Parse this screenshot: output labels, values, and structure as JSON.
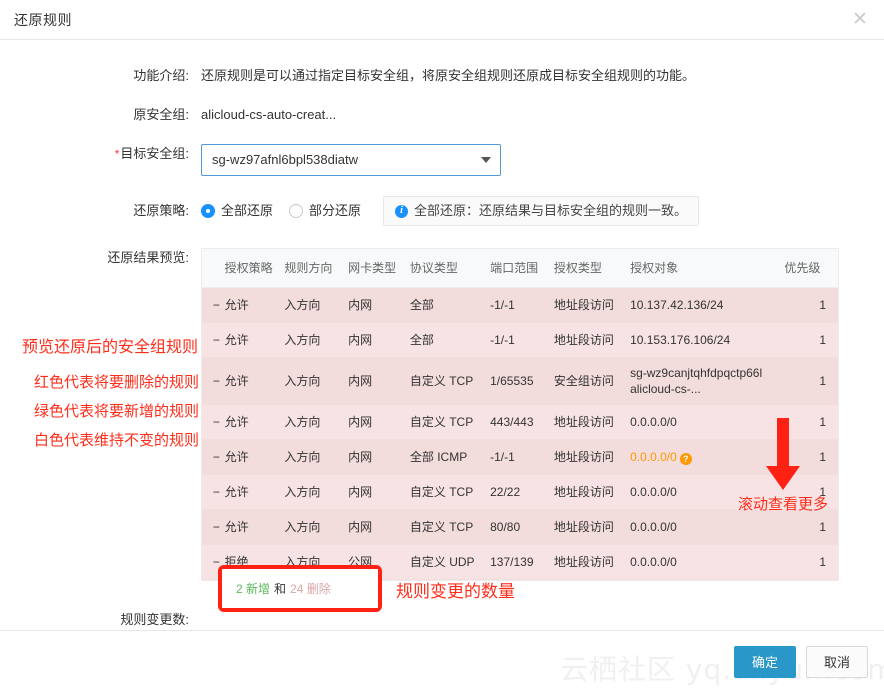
{
  "dialog": {
    "title": "还原规则",
    "close_icon": "close-icon"
  },
  "form": {
    "intro_label": "功能介绍:",
    "intro_text": "还原规则是可以通过指定目标安全组，将原安全组规则还原成目标安全组规则的功能。",
    "source_group_label": "原安全组:",
    "source_group_value": "alicloud-cs-auto-creat...",
    "target_group_label": "目标安全组:",
    "target_group_required": "*",
    "target_group_value": "sg-wz97afnl6bpl538diatw",
    "policy_label": "还原策略:",
    "policy_options": [
      {
        "label": "全部还原",
        "checked": true
      },
      {
        "label": "部分还原",
        "checked": false
      }
    ],
    "policy_tip": "全部还原：还原结果与目标安全组的规则一致。",
    "preview_label": "还原结果预览:",
    "change_label": "规则变更数:"
  },
  "table": {
    "headers": [
      "",
      "授权策略",
      "规则方向",
      "网卡类型",
      "协议类型",
      "端口范围",
      "授权类型",
      "授权对象",
      "优先级"
    ],
    "rows": [
      {
        "mark": "−",
        "policy": "允许",
        "direction": "入方向",
        "nic": "内网",
        "protocol": "全部",
        "port": "-1/-1",
        "auth_type": "地址段访问",
        "target": "10.137.42.136/24",
        "target2": "",
        "priority": "1",
        "state": "delete",
        "warn": false
      },
      {
        "mark": "−",
        "policy": "允许",
        "direction": "入方向",
        "nic": "内网",
        "protocol": "全部",
        "port": "-1/-1",
        "auth_type": "地址段访问",
        "target": "10.153.176.106/24",
        "target2": "",
        "priority": "1",
        "state": "delete",
        "warn": false
      },
      {
        "mark": "−",
        "policy": "允许",
        "direction": "入方向",
        "nic": "内网",
        "protocol": "自定义 TCP",
        "port": "1/65535",
        "auth_type": "安全组访问",
        "target": "sg-wz9canjtqhfdpqctp66l",
        "target2": "alicloud-cs-...",
        "priority": "1",
        "state": "delete",
        "warn": false
      },
      {
        "mark": "−",
        "policy": "允许",
        "direction": "入方向",
        "nic": "内网",
        "protocol": "自定义 TCP",
        "port": "443/443",
        "auth_type": "地址段访问",
        "target": "0.0.0.0/0",
        "target2": "",
        "priority": "1",
        "state": "delete",
        "warn": false
      },
      {
        "mark": "−",
        "policy": "允许",
        "direction": "入方向",
        "nic": "内网",
        "protocol": "全部 ICMP",
        "port": "-1/-1",
        "auth_type": "地址段访问",
        "target": "0.0.0.0/0",
        "target2": "",
        "priority": "1",
        "state": "delete",
        "warn": true
      },
      {
        "mark": "−",
        "policy": "允许",
        "direction": "入方向",
        "nic": "内网",
        "protocol": "自定义 TCP",
        "port": "22/22",
        "auth_type": "地址段访问",
        "target": "0.0.0.0/0",
        "target2": "",
        "priority": "1",
        "state": "delete",
        "warn": false
      },
      {
        "mark": "−",
        "policy": "允许",
        "direction": "入方向",
        "nic": "内网",
        "protocol": "自定义 TCP",
        "port": "80/80",
        "auth_type": "地址段访问",
        "target": "0.0.0.0/0",
        "target2": "",
        "priority": "1",
        "state": "delete",
        "warn": false
      },
      {
        "mark": "−",
        "policy": "拒绝",
        "direction": "入方向",
        "nic": "公网",
        "protocol": "自定义 UDP",
        "port": "137/139",
        "auth_type": "地址段访问",
        "target": "0.0.0.0/0",
        "target2": "",
        "priority": "1",
        "state": "delete",
        "warn": false
      }
    ]
  },
  "change_summary": {
    "added": "2 新增",
    "conjunction": "和",
    "removed": "24 删除"
  },
  "footer": {
    "confirm_label": "确定",
    "cancel_label": "取消"
  },
  "annotations": {
    "preview_title": "预览还原后的安全组规则",
    "red_means": "红色代表将要删除的规则",
    "green_means": "绿色代表将要新增的规则",
    "white_means": "白色代表维持不变的规则",
    "scroll_more": "滚动查看更多",
    "change_count_note": "规则变更的数量"
  },
  "watermark": "云栖社区 yq.aliyun.com",
  "colors": {
    "accent": "#2a97c9",
    "annotation_red": "#ff2d1a",
    "delete_row": "#f7e3e3",
    "added_green": "#5cb85c",
    "removed_pink": "#d9a7a7",
    "warn_orange": "#ff9900"
  }
}
